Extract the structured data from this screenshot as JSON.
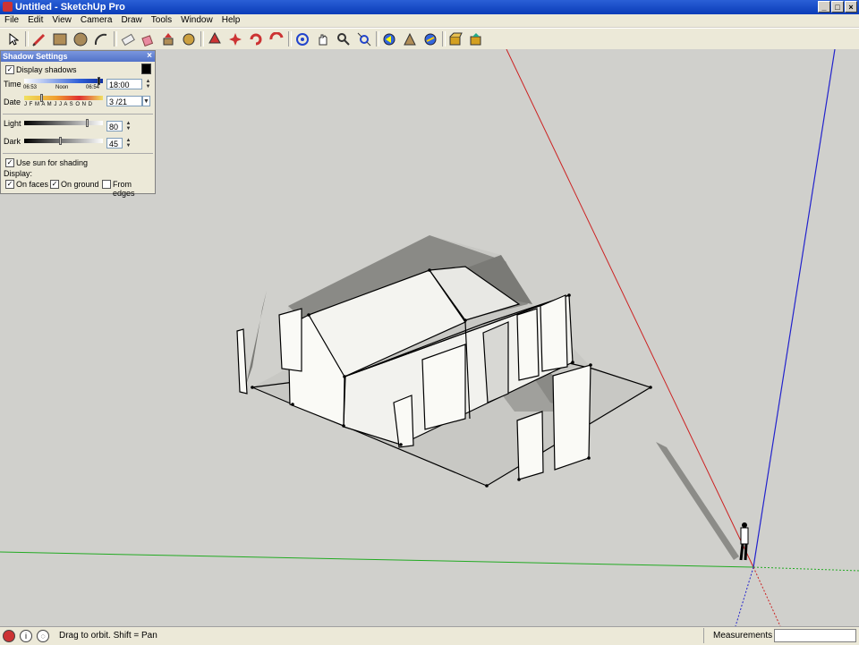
{
  "window": {
    "title": "Untitled - SketchUp Pro",
    "buttons": [
      "_",
      "□",
      "×"
    ]
  },
  "menu": [
    "File",
    "Edit",
    "View",
    "Camera",
    "Draw",
    "Tools",
    "Window",
    "Help"
  ],
  "toolbar": {
    "icons": [
      "select-icon",
      "pencil-icon",
      "rectangle-icon",
      "circle-icon",
      "arc-icon",
      "eraser-icon",
      "paint-bucket-icon",
      "push-pull-icon",
      "move-icon",
      "rotate-icon",
      "follow-me-icon",
      "offset-icon",
      "tape-measure-icon",
      "text-icon",
      "zoom-icon",
      "zoom-extents-icon",
      "orbit-icon",
      "pan-icon",
      "walk-icon",
      "look-around-icon",
      "get-models-icon",
      "share-model-icon"
    ]
  },
  "shadow_panel": {
    "title": "Shadow Settings",
    "close": "×",
    "display_shadows": "Display shadows",
    "time_label": "Time",
    "time_start": "06:53",
    "time_noon": "Noon",
    "time_end": "06:54",
    "time_value": "18:00",
    "date_label": "Date",
    "months": "J F M A M J J A S O N D",
    "date_value": "3 /21",
    "light_label": "Light",
    "light_value": "80",
    "light_level": 0.8,
    "dark_label": "Dark",
    "dark_value": "45",
    "dark_level": 0.45,
    "use_sun": "Use sun for shading",
    "display_label": "Display:",
    "on_faces": "On faces",
    "on_ground": "On ground",
    "from_edges": "From edges",
    "check": "✓"
  },
  "status": {
    "hint": "Drag to orbit.  Shift = Pan",
    "measurements_label": "Measurements",
    "measurements_value": ""
  },
  "colors": {
    "red_axis": "#cc2222",
    "green_axis": "#22aa22",
    "blue_axis": "#2222cc",
    "sky_ground": "#d0d0cc"
  }
}
